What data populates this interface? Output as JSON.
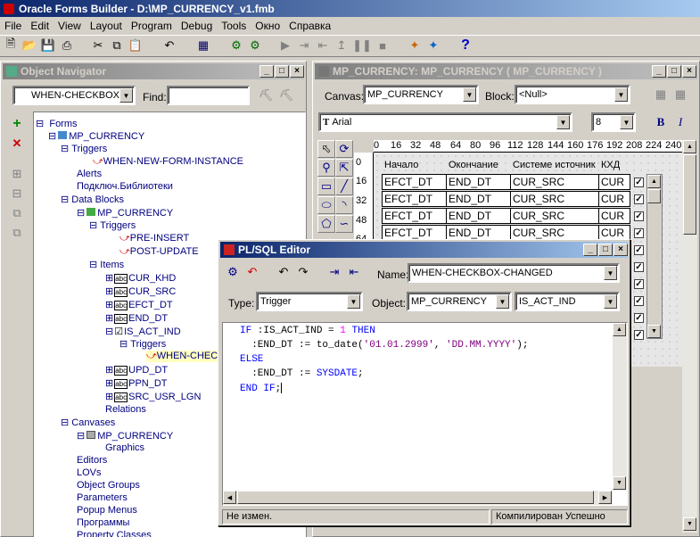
{
  "app": {
    "title": "Oracle Forms Builder - D:\\MP_CURRENCY_v1.fmb"
  },
  "menu": [
    "File",
    "Edit",
    "View",
    "Layout",
    "Program",
    "Debug",
    "Tools",
    "Окно",
    "Справка"
  ],
  "navigator": {
    "title": "Object Navigator",
    "selector_value": "WHEN-CHECKBOX-C",
    "find_label": "Find:",
    "find_value": "",
    "tree": {
      "forms": "Forms",
      "form": "MP_CURRENCY",
      "triggers": "Triggers",
      "form_trigger": "WHEN-NEW-FORM-INSTANCE",
      "alerts": "Alerts",
      "libraries": "Подключ.Библиотеки",
      "data_blocks": "Data Blocks",
      "block": "MP_CURRENCY",
      "block_triggers": "Triggers",
      "pre_insert": "PRE-INSERT",
      "post_update": "POST-UPDATE",
      "items": "Items",
      "item_list_top": [
        "CUR_KHD",
        "CUR_SRC",
        "EFCT_DT",
        "END_DT"
      ],
      "is_act_ind": "IS_ACT_IND",
      "item_triggers": "Triggers",
      "when_check": "WHEN-CHECK",
      "item_list_bottom": [
        "UPD_DT",
        "PPN_DT",
        "SRC_USR_LGN"
      ],
      "relations": "Relations",
      "canvases": "Canvases",
      "canvas": "MP_CURRENCY",
      "graphics": "Graphics",
      "bottom_nodes": [
        "Editors",
        "LOVs",
        "Object Groups",
        "Parameters",
        "Popup Menus",
        "Программы",
        "Property Classes"
      ]
    }
  },
  "layout_editor": {
    "title": "MP_CURRENCY: MP_CURRENCY ( MP_CURRENCY )",
    "canvas_label": "Canvas:",
    "canvas_value": "MP_CURRENCY",
    "block_label": "Block:",
    "block_value": "<Null>",
    "font_value": "Arial",
    "font_size": "8",
    "bold_label": "B",
    "italic_label": "I",
    "ruler_h": [
      "0",
      "16",
      "32",
      "48",
      "64",
      "80",
      "96",
      "112",
      "128",
      "144",
      "160",
      "176",
      "192",
      "208",
      "224",
      "240"
    ],
    "ruler_v": [
      "0",
      "16",
      "32",
      "48",
      "64"
    ],
    "headers": [
      "Начало",
      "Окончание",
      "Системе источник",
      "КХД"
    ],
    "rows": [
      [
        "EFCT_DT",
        "END_DT",
        "CUR_SRC",
        "CUR"
      ],
      [
        "EFCT_DT",
        "END_DT",
        "CUR_SRC",
        "CUR"
      ],
      [
        "EFCT_DT",
        "END_DT",
        "CUR_SRC",
        "CUR"
      ],
      [
        "EFCT_DT",
        "END_DT",
        "CUR_SRC",
        "CUR"
      ]
    ]
  },
  "plsql": {
    "title": "PL/SQL Editor",
    "name_label": "Name:",
    "name_value": "WHEN-CHECKBOX-CHANGED",
    "type_label": "Type:",
    "type_value": "Trigger",
    "object_label": "Object:",
    "object_value": "MP_CURRENCY",
    "item_value": "IS_ACT_IND",
    "code": {
      "l1_kw1": "IF",
      "l1_a": " :IS_ACT_IND = ",
      "l1_num": "1",
      "l1_kw2": "THEN",
      "l2_a": "  :END_DT := to_date(",
      "l2_s1": "'01.01.2999'",
      "l2_b": ", ",
      "l2_s2": "'DD.MM.YYYY'",
      "l2_c": ");",
      "l3": "ELSE",
      "l4_a": "  :END_DT := ",
      "l4_kw": "SYSDATE",
      "l4_b": ";",
      "l5_kw": "END IF",
      "l5_b": ";"
    },
    "status_left": "Не измен.",
    "status_right": "Компилирован Успешно"
  },
  "colors": {
    "title_active": "#0a246a",
    "title_gradient_end": "#a6caf0",
    "face": "#d4d0c8",
    "tree_text": "#000080",
    "selected_bg": "#ffffc0"
  }
}
